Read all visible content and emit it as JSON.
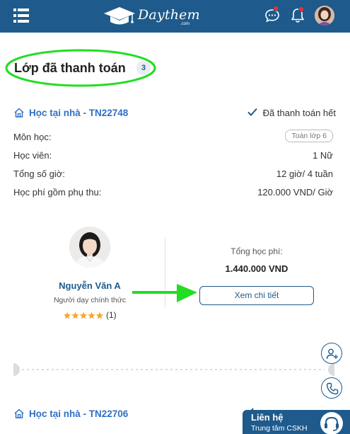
{
  "header": {
    "logo_text": "Daythem",
    "logo_sub": ".com",
    "menu_icon": "hamburger-menu-icon",
    "chat_icon": "chat-bubble-icon",
    "bell_icon": "bell-icon",
    "brand_color": "#1e5b8c",
    "badge_color": "#ff2a2a"
  },
  "page": {
    "title": "Lớp đã thanh toán",
    "count": "3"
  },
  "class_card": {
    "code": "Học tại nhà - TN22748",
    "status": "Đã thanh toán hết",
    "rows": [
      {
        "label": "Môn học:",
        "value": "Toán lớp 6"
      },
      {
        "label": "Học viên:",
        "value": "1 Nữ"
      },
      {
        "label": "Tổng số giờ:",
        "value": "12 giờ/ 4 tuần"
      },
      {
        "label": "Học phí gồm phụ thu:",
        "value": "120.000 VND/ Giờ"
      }
    ],
    "tutor": {
      "name": "Nguyễn Văn A",
      "role": "Người dạy chính thức",
      "rating_stars": 5,
      "rating_count": "(1)"
    },
    "total_label": "Tổng học phí:",
    "total_value": "1.440.000 VND",
    "detail_button": "Xem chi tiết"
  },
  "class_card_2": {
    "code": "Học tại nhà - TN22706"
  },
  "floating": {
    "add_user_icon": "add-user-icon",
    "phone_icon": "phone-icon"
  },
  "support": {
    "title": "Liên hệ",
    "subtitle": "Trung tâm CSKH",
    "icon": "headset-icon"
  },
  "annotation_color": "#22dd22"
}
